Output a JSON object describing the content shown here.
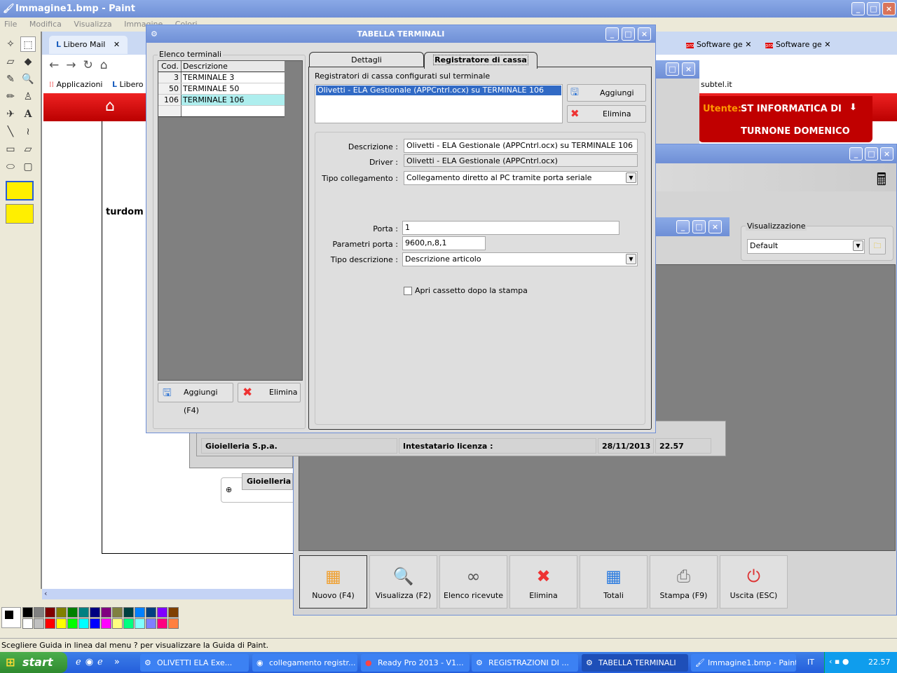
{
  "paint": {
    "title": "Immagine1.bmp - Paint",
    "menu": [
      "File",
      "Modifica",
      "Visualizza",
      "Immagine",
      "Colori",
      "?"
    ],
    "status": "Scegliere Guida in linea dal menu ? per visualizzare la Guida di Paint.",
    "palette_top": [
      "#000000",
      "#808080",
      "#800000",
      "#808000",
      "#008000",
      "#008080",
      "#000080",
      "#800080",
      "#808040",
      "#004040",
      "#0080ff",
      "#004080",
      "#8000ff",
      "#804000"
    ],
    "palette_bottom": [
      "#ffffff",
      "#c0c0c0",
      "#ff0000",
      "#ffff00",
      "#00ff00",
      "#00ffff",
      "#0000ff",
      "#ff00ff",
      "#ffff80",
      "#00ff80",
      "#80ffff",
      "#8080ff",
      "#ff0080",
      "#ff8040"
    ]
  },
  "browser": {
    "tabs": [
      "Libero Mail",
      "Software ge",
      "Software ge"
    ],
    "bookmarks": [
      "Applicazioni",
      "Libero"
    ],
    "url_fragment": "subtel.it",
    "user_label": "Utente:",
    "user_name_1": "ST INFORMATICA DI",
    "user_name_2": "TURNONE DOMENICO",
    "page_text": "turdom",
    "company_partial": "Gioielleria S"
  },
  "main_window": {
    "view_group_label": "Visualizzazione",
    "view_value": "Default",
    "status": {
      "company": "Gioielleria S.p.a.",
      "license_label": "Intestatario licenza :",
      "date": "28/11/2013",
      "time": "22.57"
    },
    "buttons": [
      {
        "label": "Nuovo (F4)",
        "icon": "new-grid-icon"
      },
      {
        "label": "Visualizza (F2)",
        "icon": "view-document-icon"
      },
      {
        "label": "Elenco ricevute",
        "icon": "binoculars-icon"
      },
      {
        "label": "Elimina",
        "icon": "delete-x-icon"
      },
      {
        "label": "Totali",
        "icon": "calculator-icon"
      },
      {
        "label": "Stampa (F9)",
        "icon": "printer-icon"
      },
      {
        "label": "Uscita (ESC)",
        "icon": "exit-icon"
      }
    ]
  },
  "dialog": {
    "title": "TABELLA TERMINALI",
    "list_group": "Elenco terminali",
    "columns": [
      "Cod.",
      "Descrizione"
    ],
    "rows": [
      {
        "cod": "3",
        "desc": "TERMINALE 3"
      },
      {
        "cod": "50",
        "desc": "TERMINALE 50"
      },
      {
        "cod": "106",
        "desc": "TERMINALE 106",
        "selected": true
      }
    ],
    "add_button": "Aggiungi (F4)",
    "delete_button": "Elimina",
    "tabs": [
      "Dettagli",
      "Registratore di cassa"
    ],
    "active_tab": 1,
    "registers_label": "Registratori di cassa configurati sul terminale",
    "registers": [
      "Olivetti - ELA Gestionale (APPCntrl.ocx) su TERMINALE 106"
    ],
    "reg_add": "Aggiungi",
    "reg_delete": "Elimina",
    "fields": {
      "descrizione_label": "Descrizione :",
      "descrizione": "Olivetti - ELA Gestionale (APPCntrl.ocx) su TERMINALE 106",
      "driver_label": "Driver :",
      "driver": "Olivetti - ELA Gestionale (APPCntrl.ocx)",
      "collegamento_label": "Tipo collegamento :",
      "collegamento": "Collegamento diretto al PC tramite porta seriale",
      "porta_label": "Porta :",
      "porta": "1",
      "parametri_label": "Parametri porta :",
      "parametri": "9600,n,8,1",
      "tipo_desc_label": "Tipo descrizione :",
      "tipo_desc": "Descrizione articolo",
      "cassetto_label": "Apri cassetto dopo la stampa",
      "cassetto": false
    }
  },
  "taskbar": {
    "start": "start",
    "items": [
      "OLIVETTI   ELA Exe...",
      "collegamento registr...",
      "Ready Pro 2013 - V1...",
      "REGISTRAZIONI DI ...",
      "TABELLA TERMINALI",
      "Immagine1.bmp - Paint"
    ],
    "active_item": 4,
    "lang": "IT",
    "clock": "22.57"
  }
}
